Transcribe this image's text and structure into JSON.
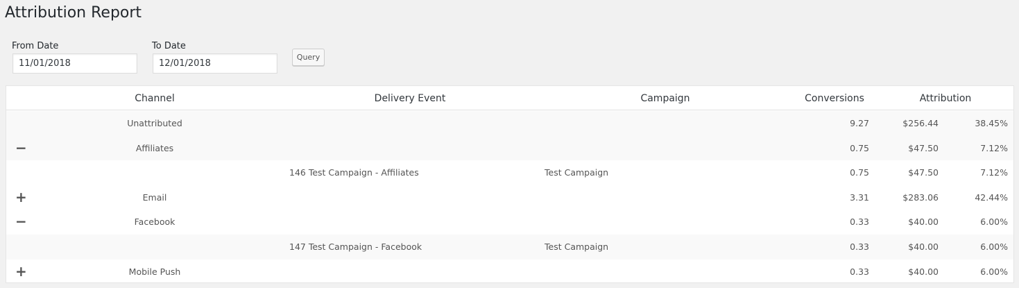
{
  "page_title": "Attribution Report",
  "filters": {
    "from_label": "From Date",
    "from_value": "11/01/2018",
    "to_label": "To Date",
    "to_value": "12/01/2018",
    "query_label": "Query"
  },
  "table": {
    "headers": {
      "channel": "Channel",
      "delivery_event": "Delivery Event",
      "campaign": "Campaign",
      "conversions": "Conversions",
      "attribution": "Attribution"
    },
    "rows": [
      {
        "toggle": "",
        "channel": "Unattributed",
        "delivery_event": "",
        "campaign": "",
        "conversions": "9.27",
        "amount": "$256.44",
        "percent": "38.45%"
      },
      {
        "toggle": "−",
        "channel": "Affiliates",
        "delivery_event": "",
        "campaign": "",
        "conversions": "0.75",
        "amount": "$47.50",
        "percent": "7.12%"
      },
      {
        "toggle": "",
        "channel": "",
        "delivery_event": "146 Test Campaign - Affiliates",
        "campaign": "Test Campaign",
        "conversions": "0.75",
        "amount": "$47.50",
        "percent": "7.12%"
      },
      {
        "toggle": "+",
        "channel": "Email",
        "delivery_event": "",
        "campaign": "",
        "conversions": "3.31",
        "amount": "$283.06",
        "percent": "42.44%"
      },
      {
        "toggle": "−",
        "channel": "Facebook",
        "delivery_event": "",
        "campaign": "",
        "conversions": "0.33",
        "amount": "$40.00",
        "percent": "6.00%"
      },
      {
        "toggle": "",
        "channel": "",
        "delivery_event": "147 Test Campaign - Facebook",
        "campaign": "Test Campaign",
        "conversions": "0.33",
        "amount": "$40.00",
        "percent": "6.00%"
      },
      {
        "toggle": "+",
        "channel": "Mobile Push",
        "delivery_event": "",
        "campaign": "",
        "conversions": "0.33",
        "amount": "$40.00",
        "percent": "6.00%"
      }
    ]
  }
}
